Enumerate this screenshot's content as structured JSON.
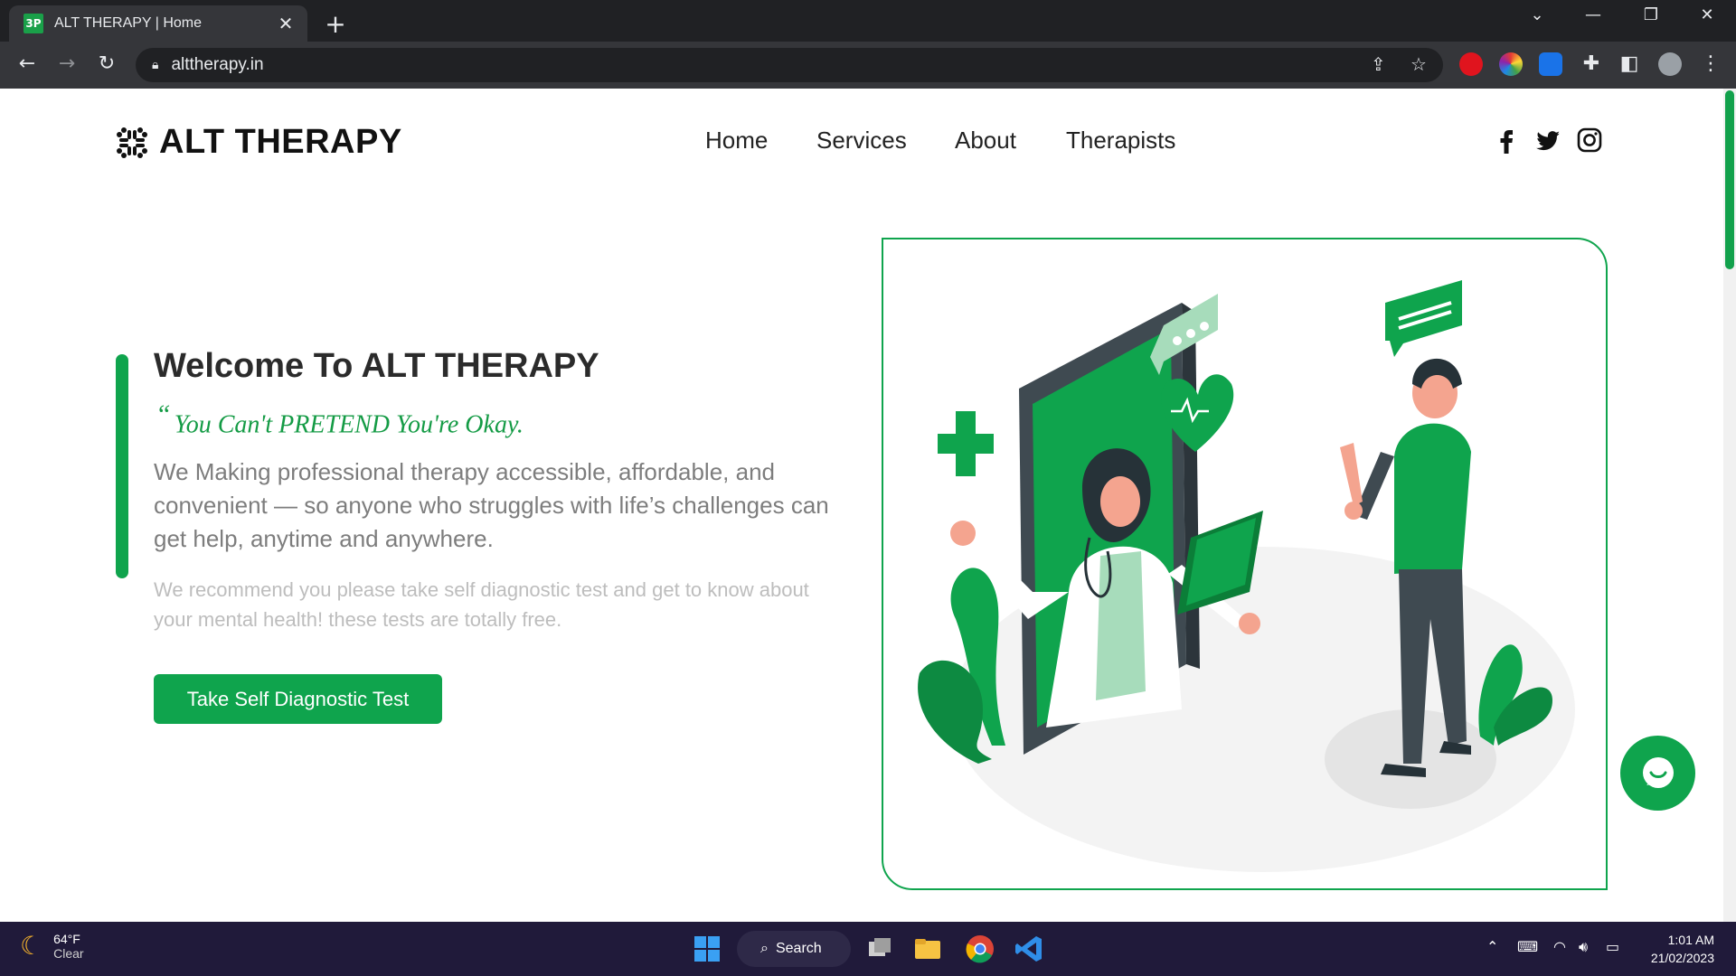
{
  "browser": {
    "tab_title": "ALT THERAPY | Home",
    "tab_favicon_text": "3P",
    "url": "alttherapy.in",
    "new_tab_label": "+",
    "close_label": "✕"
  },
  "site": {
    "logo_text": "ALT THERAPY",
    "nav": [
      "Home",
      "Services",
      "About",
      "Therapists"
    ],
    "social_icons": [
      "facebook-icon",
      "twitter-icon",
      "instagram-icon"
    ]
  },
  "hero": {
    "title": "Welcome To ALT THERAPY",
    "tagline_quote": "“",
    "tagline": "You Can't PRETEND You're Okay.",
    "description": "We Making professional therapy accessible, affordable, and convenient — so anyone who struggles with life’s challenges can get help, anytime and anywhere.",
    "recommendation": "We recommend you please take self diagnostic test and get to know about your mental health! these tests are totally free.",
    "cta_label": "Take Self Diagnostic Test"
  },
  "colors": {
    "brand_green": "#0fa44d",
    "tagline_green": "#149b45",
    "taskbar": "#201a3a"
  },
  "taskbar": {
    "weather_temp": "64°F",
    "weather_condition": "Clear",
    "search_label": "Search",
    "time": "1:01 AM",
    "date": "21/02/2023"
  }
}
